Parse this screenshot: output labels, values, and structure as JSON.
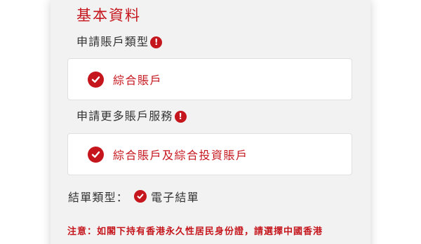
{
  "section": {
    "title": "基本資料"
  },
  "account_type": {
    "label": "申請賬戶類型",
    "required_icon": "exclamation-icon",
    "selected_option": "綜合賬戶"
  },
  "more_services": {
    "label": "申請更多賬戶服務",
    "required_icon": "exclamation-icon",
    "selected_option": "綜合賬戶及綜合投資賬戶"
  },
  "statement": {
    "label": "結單類型：",
    "value": "電子結單"
  },
  "note": {
    "text": "注意：如閣下持有香港永久性居民身份證，請選擇中國香港"
  },
  "colors": {
    "accent": "#c5161d",
    "card_background": "#f2f2f2",
    "option_background": "#ffffff",
    "text": "#333333"
  }
}
